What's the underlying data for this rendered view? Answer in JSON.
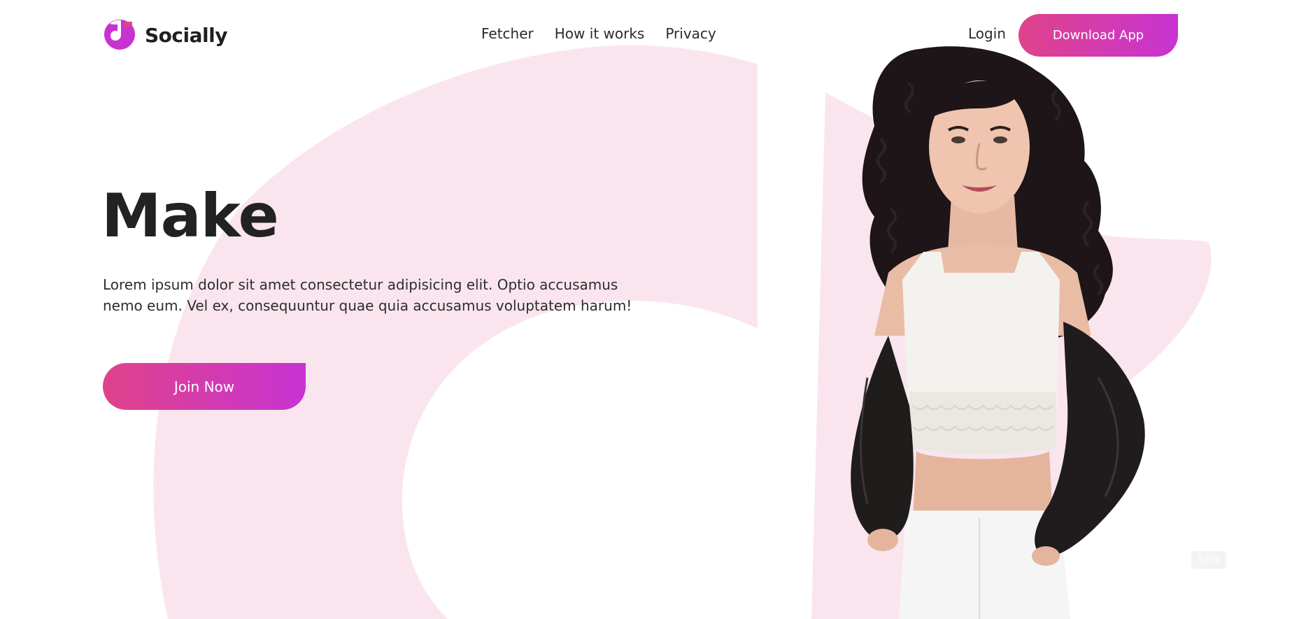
{
  "brand": {
    "name": "Socially",
    "logo_icon": "music-note-logo-icon"
  },
  "nav": {
    "items": [
      {
        "label": "Fetcher"
      },
      {
        "label": "How it works"
      },
      {
        "label": "Privacy"
      }
    ]
  },
  "header": {
    "login_label": "Login",
    "download_label": "Download App"
  },
  "hero": {
    "title": "Make",
    "description": "Lorem ipsum dolor sit amet consectetur adipisicing elit. Optio accusamus nemo eum. Vel ex, consequuntur quae quia accusamus voluptatem harum!",
    "cta_label": "Join Now",
    "image": "woman-in-white-top-and-leather-jacket"
  },
  "misc": {
    "save_label": "Save"
  },
  "colors": {
    "accent_start": "#e0438a",
    "accent_end": "#c733d2",
    "shape_pink": "#fae5ef",
    "text": "#222222"
  }
}
